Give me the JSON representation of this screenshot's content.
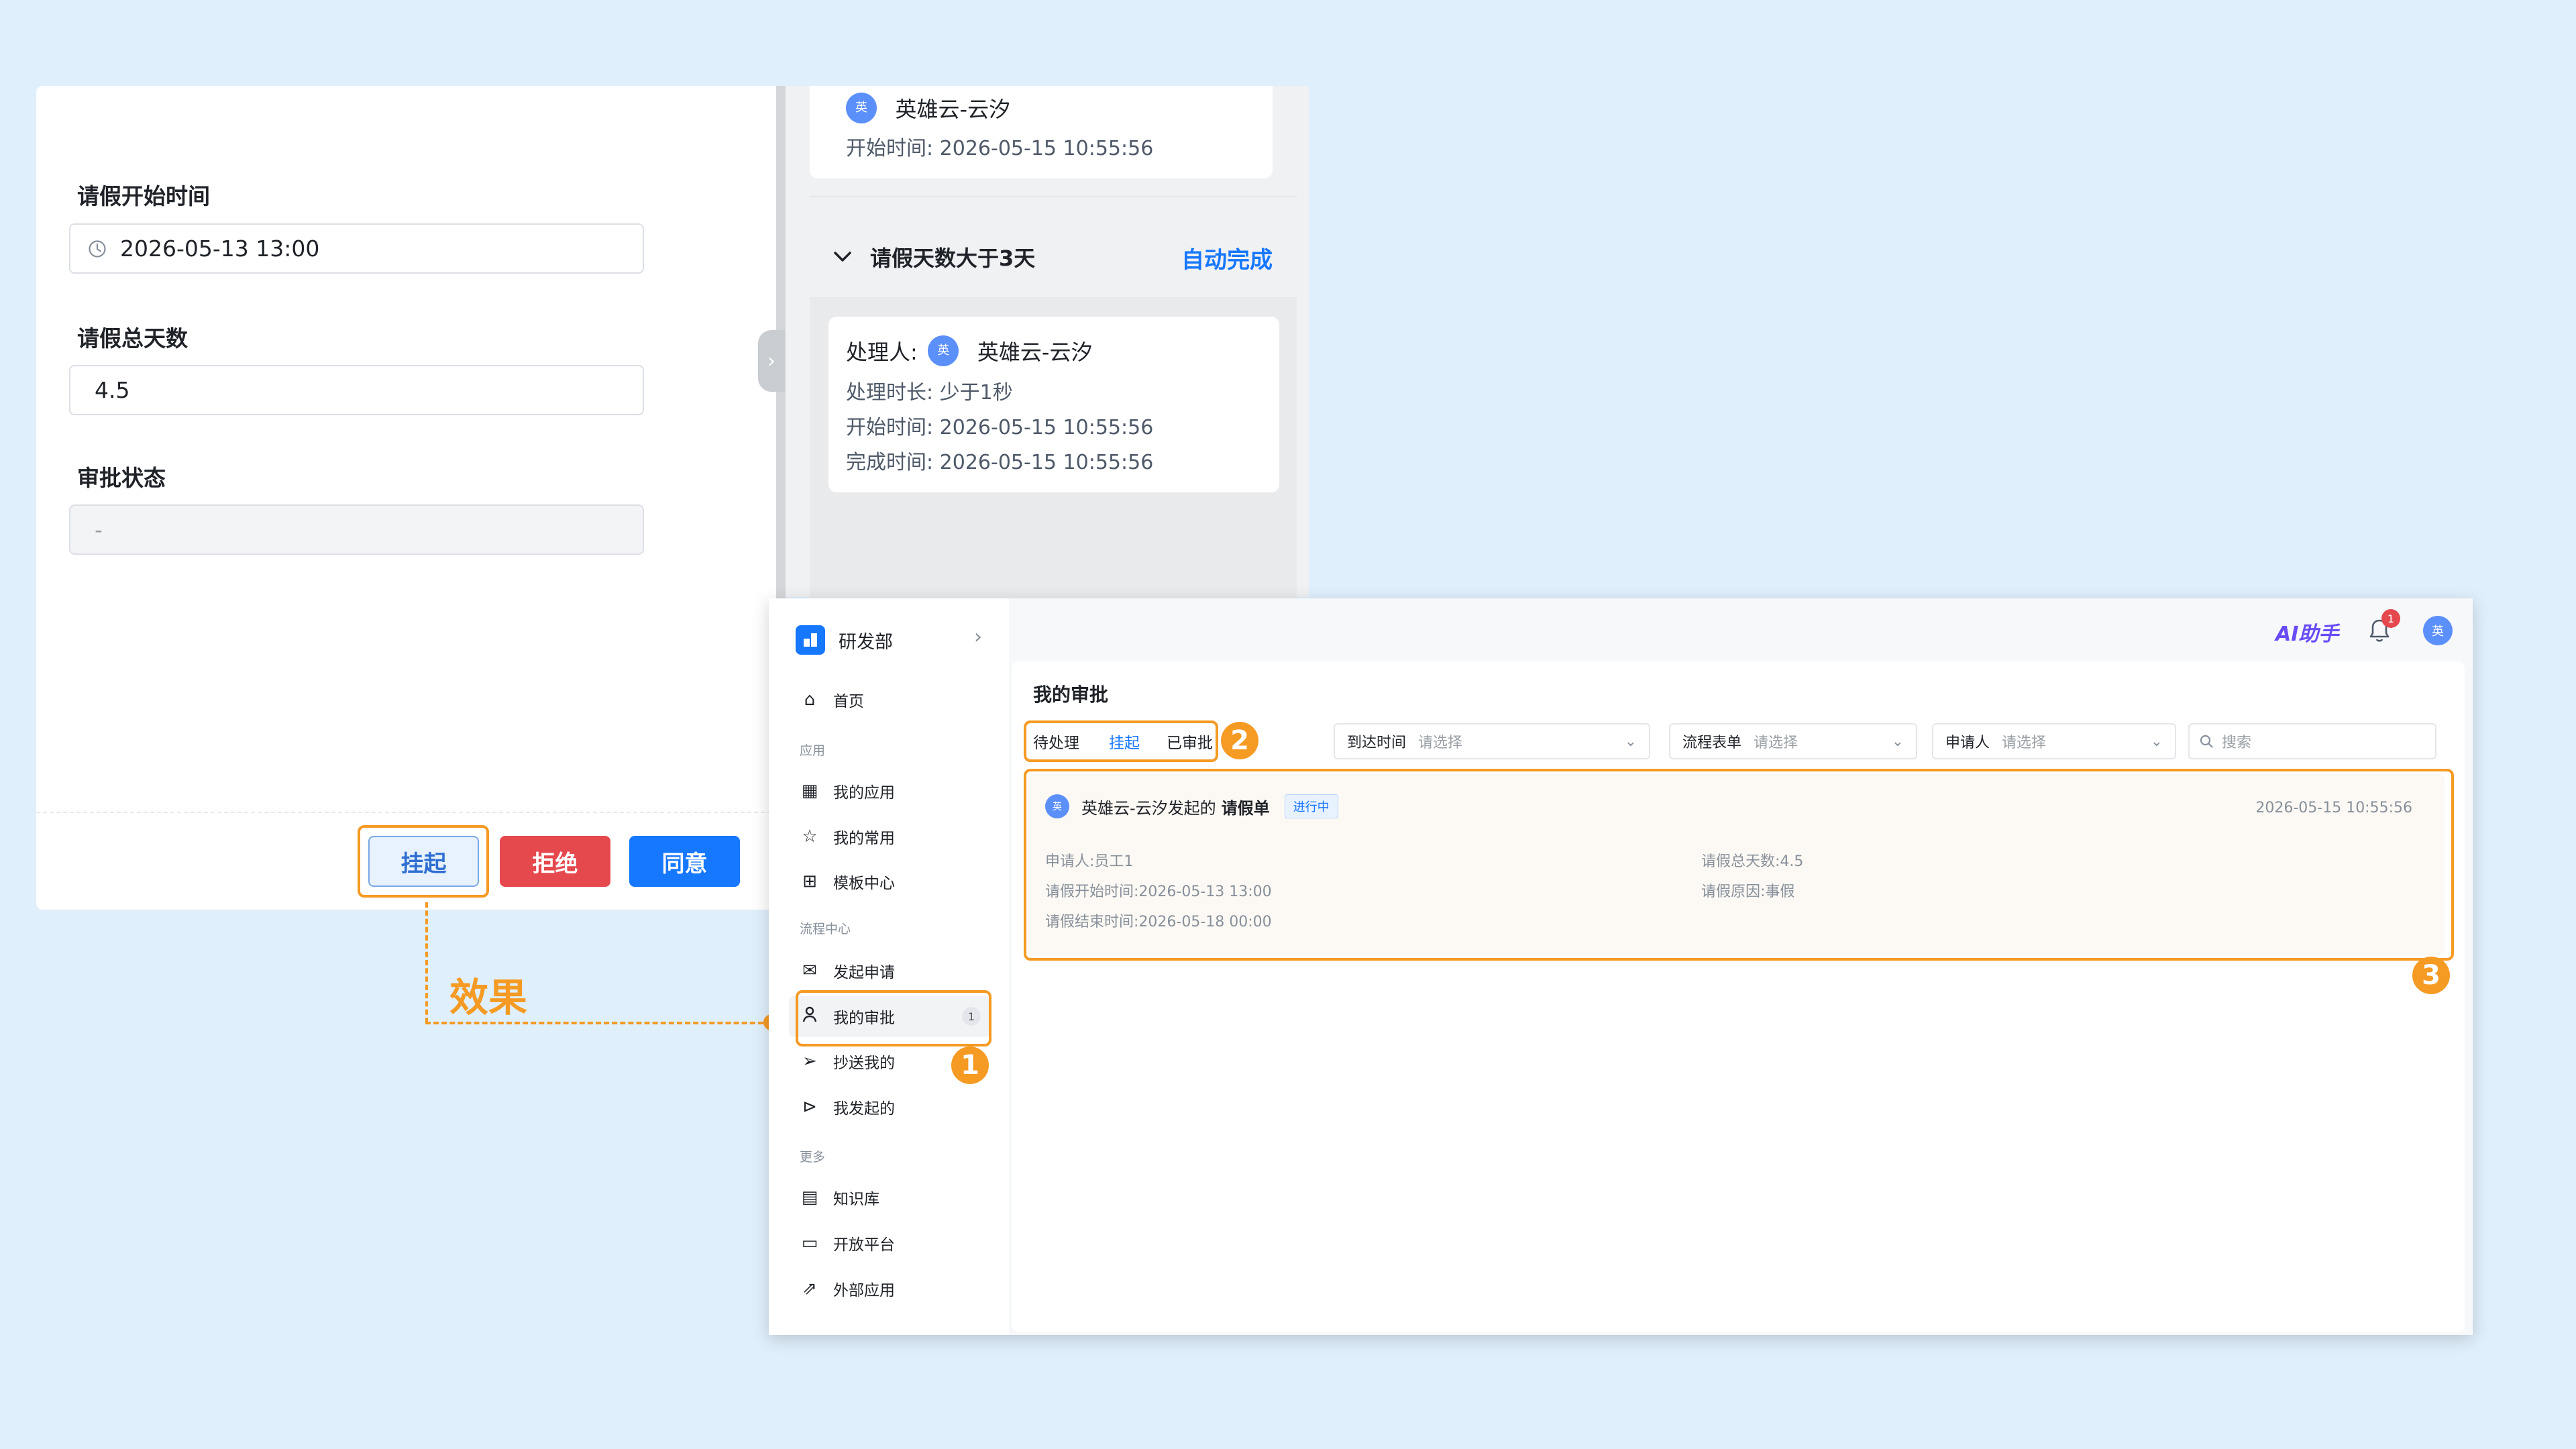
{
  "form": {
    "start_time_label": "请假开始时间",
    "start_time_value": "2026-05-13 13:00",
    "total_days_label": "请假总天数",
    "total_days_value": "4.5",
    "status_label": "审批状态",
    "status_value": "-",
    "buttons": {
      "suspend": "挂起",
      "reject": "拒绝",
      "agree": "同意"
    }
  },
  "flow": {
    "top_card": {
      "avatar": "英",
      "name": "英雄云-云汐",
      "start_label": "开始时间:",
      "start_value": "2026-05-15 10:55:56"
    },
    "node": {
      "title": "请假天数大于3天",
      "status": "自动完成"
    },
    "handler_card": {
      "handler_label": "处理人:",
      "avatar": "英",
      "name": "英雄云-云汐",
      "duration_label": "处理时长:",
      "duration_value": "少于1秒",
      "start_label": "开始时间:",
      "start_value": "2026-05-15 10:55:56",
      "done_label": "完成时间:",
      "done_value": "2026-05-15 10:55:56"
    }
  },
  "annotation": {
    "effect": "效果",
    "badge1": "1",
    "badge2": "2",
    "badge3": "3"
  },
  "app": {
    "org_name": "研发部",
    "ai_label": "AI助手",
    "notif_count": "1",
    "user_avatar": "英",
    "sidebar": {
      "home": "首页",
      "group_apps": "应用",
      "my_apps": "我的应用",
      "my_common": "我的常用",
      "template_center": "模板中心",
      "group_process": "流程中心",
      "start_request": "发起申请",
      "my_approval": "我的审批",
      "my_approval_count": "1",
      "cc_me": "抄送我的",
      "started_by_me": "我发起的",
      "group_more": "更多",
      "knowledge": "知识库",
      "open_platform": "开放平台",
      "external_apps": "外部应用"
    },
    "page_title": "我的审批",
    "tabs": [
      "待处理",
      "挂起",
      "已审批"
    ],
    "active_tab": "挂起",
    "filters": {
      "arrival_label": "到达时间",
      "arrival_placeholder": "请选择",
      "form_label": "流程表单",
      "form_placeholder": "请选择",
      "applicant_label": "申请人",
      "applicant_placeholder": "请选择",
      "search_placeholder": "搜索"
    },
    "item": {
      "avatar": "英",
      "title_prefix": "英雄云-云汐发起的",
      "title_form": "请假单",
      "status": "进行中",
      "time": "2026-05-15 10:55:56",
      "applicant": "申请人:员工1",
      "start_time": "请假开始时间:2026-05-13 13:00",
      "end_time": "请假结束时间:2026-05-18 00:00",
      "total_days": "请假总天数:4.5",
      "reason": "请假原因:事假"
    }
  },
  "colors": {
    "accent": "#1677ff",
    "danger": "#e5484d",
    "annotation": "#f59a23",
    "background": "#e0effc"
  }
}
